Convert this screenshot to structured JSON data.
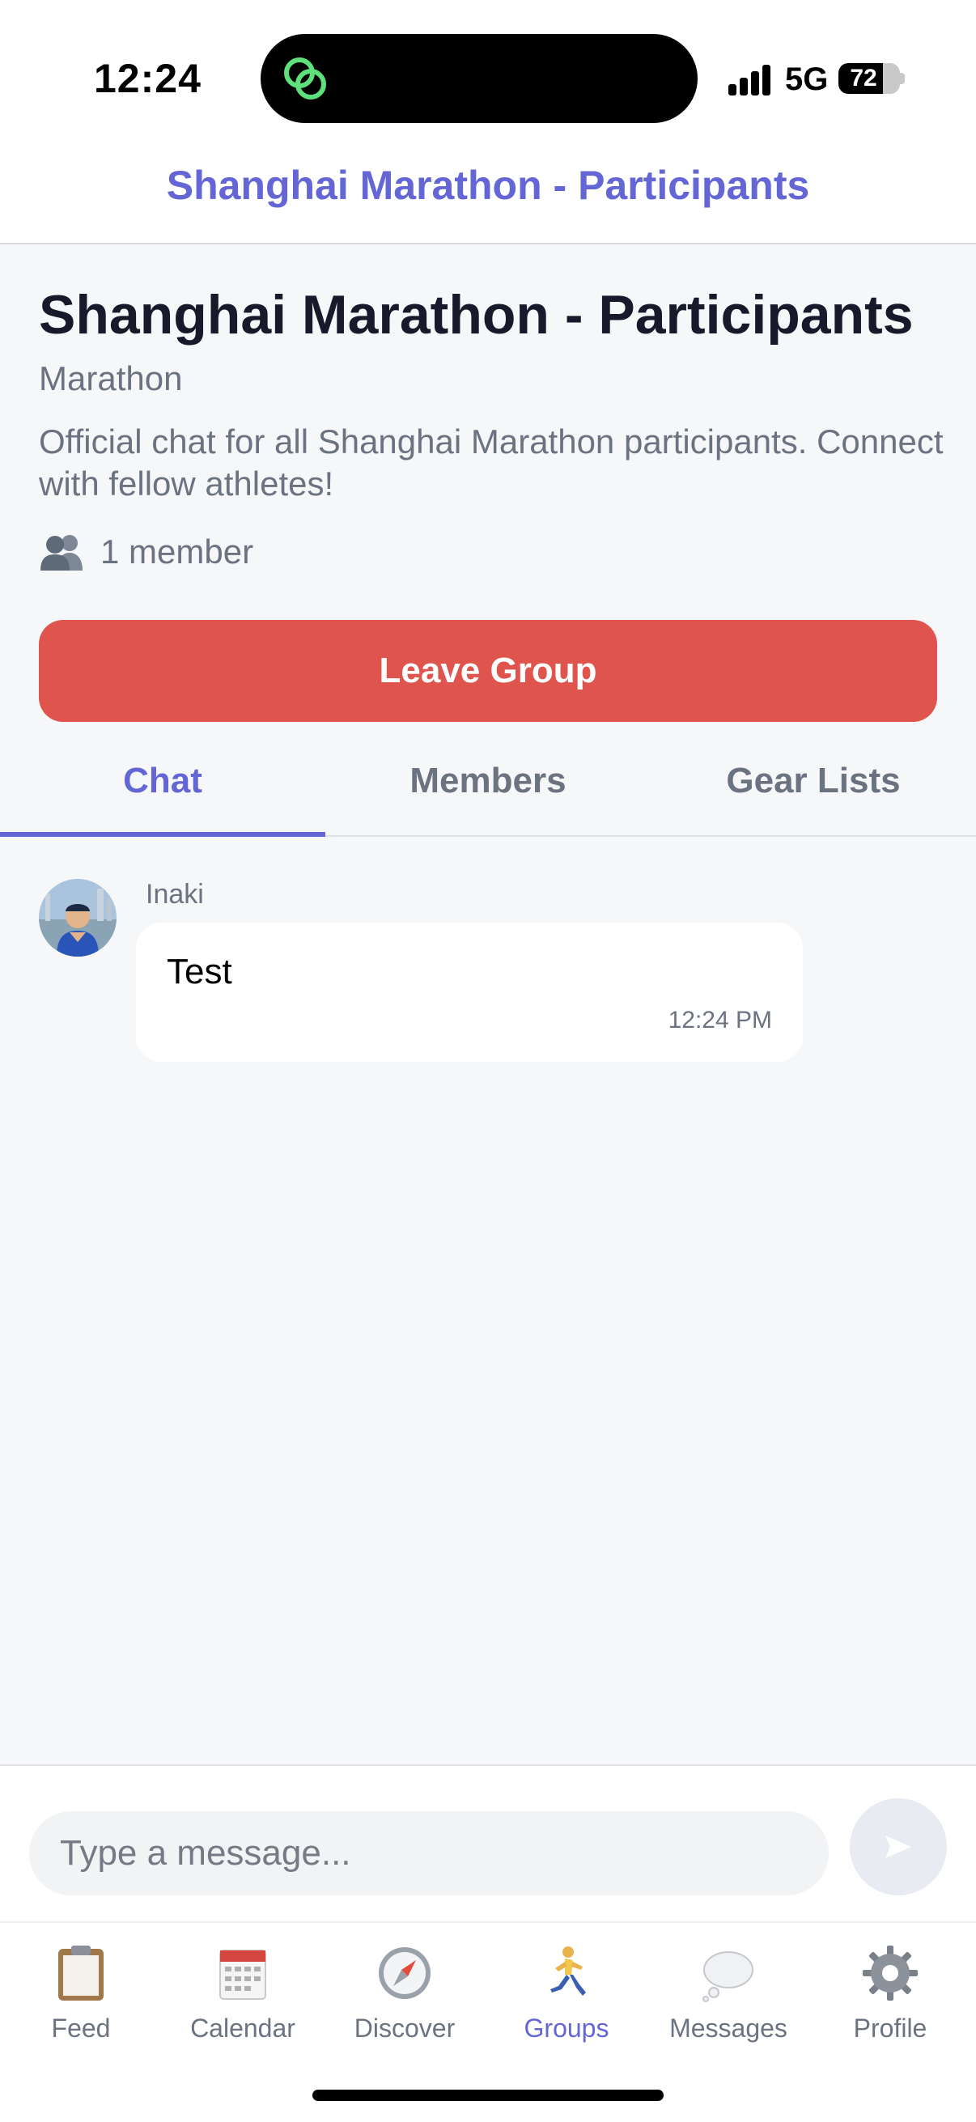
{
  "status_bar": {
    "time": "12:24",
    "network": "5G",
    "battery_percent": "72",
    "battery_level": 0.72
  },
  "header": {
    "title": "Shanghai Marathon - Participants"
  },
  "group": {
    "title": "Shanghai Marathon - Participants",
    "type": "Marathon",
    "description": "Official chat for all Shanghai Marathon participants. Connect with fellow athletes!",
    "member_count": "1 member",
    "leave_label": "Leave Group"
  },
  "tabs": [
    {
      "label": "Chat",
      "active": true
    },
    {
      "label": "Members",
      "active": false
    },
    {
      "label": "Gear Lists",
      "active": false
    }
  ],
  "messages": [
    {
      "sender": "Inaki",
      "text": "Test",
      "time": "12:24 PM"
    }
  ],
  "composer": {
    "placeholder": "Type a message..."
  },
  "tabbar": [
    {
      "label": "Feed",
      "icon": "clipboard-icon"
    },
    {
      "label": "Calendar",
      "icon": "calendar-icon"
    },
    {
      "label": "Discover",
      "icon": "compass-icon"
    },
    {
      "label": "Groups",
      "icon": "runner-icon",
      "active": true
    },
    {
      "label": "Messages",
      "icon": "thought-bubble-icon"
    },
    {
      "label": "Profile",
      "icon": "gear-icon"
    }
  ],
  "colors": {
    "accent": "#6366d4",
    "danger": "#df544c",
    "background": "#f6f7f9",
    "muted_text": "#6b7280"
  }
}
